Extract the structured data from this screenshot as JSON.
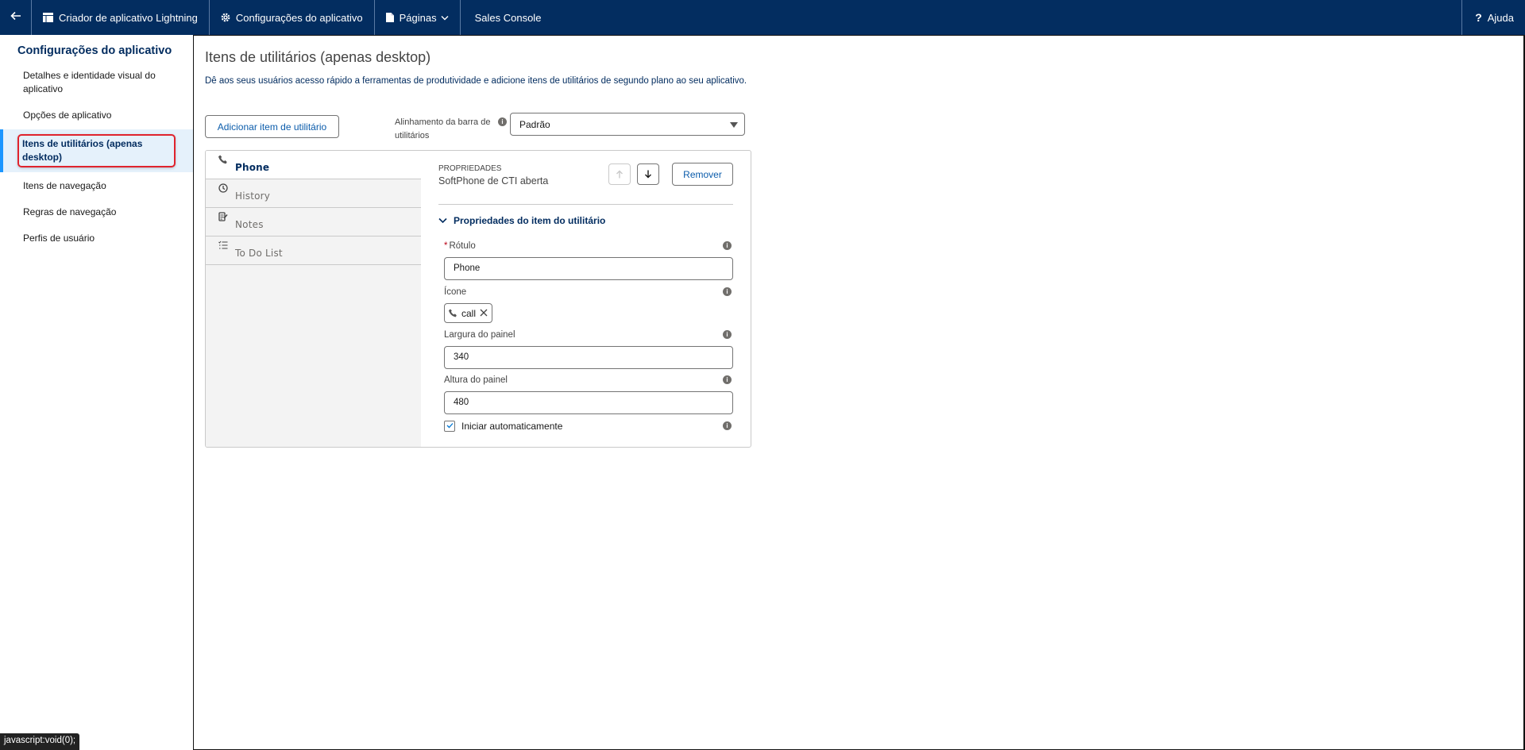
{
  "topbar": {
    "back_icon": "arrow-left-icon",
    "items": [
      {
        "label": "Criador de aplicativo Lightning",
        "icon": "app-builder-icon"
      },
      {
        "label": "Configurações do aplicativo",
        "icon": "gear-icon"
      },
      {
        "label": "Páginas",
        "icon": "page-icon",
        "dropdown": true
      },
      {
        "label": "Sales Console"
      }
    ],
    "help": {
      "label": "Ajuda",
      "icon": "question-icon"
    }
  },
  "sidebar": {
    "title": "Configurações do aplicativo",
    "items": [
      {
        "label": "Detalhes e identidade visual do aplicativo",
        "active": false
      },
      {
        "label": "Opções de aplicativo",
        "active": false
      },
      {
        "label": "Itens de utilitários (apenas desktop)",
        "active": true
      },
      {
        "label": "Itens de navegação",
        "active": false
      },
      {
        "label": "Regras de navegação",
        "active": false
      },
      {
        "label": "Perfis de usuário",
        "active": false
      }
    ]
  },
  "main": {
    "title": "Itens de utilitários (apenas desktop)",
    "description": "Dê aos seus usuários acesso rápido a ferramentas de produtividade e adicione itens de utilitários de segundo plano ao seu aplicativo.",
    "add_button": "Adicionar item de utilitário",
    "alignment": {
      "label": "Alinhamento da barra de utilitários",
      "value": "Padrão"
    },
    "utility_items": [
      {
        "label": "Phone",
        "icon": "phone-icon",
        "selected": true
      },
      {
        "label": "History",
        "icon": "clock-icon",
        "selected": false
      },
      {
        "label": "Notes",
        "icon": "notes-icon",
        "selected": false
      },
      {
        "label": "To Do List",
        "icon": "checklist-icon",
        "selected": false
      }
    ],
    "properties": {
      "caption": "PROPRIEDADES",
      "name": "SoftPhone de CTI aberta",
      "move_up_icon": "arrow-up-icon",
      "move_down_icon": "arrow-down-icon",
      "remove_button": "Remover",
      "section_title": "Propriedades do item do utilitário",
      "label_field": {
        "label": "Rótulo",
        "required_mark": "*",
        "value": "Phone"
      },
      "icon_field": {
        "label": "Ícone",
        "value": "call"
      },
      "width_field": {
        "label": "Largura do painel",
        "value": "340"
      },
      "height_field": {
        "label": "Altura do painel",
        "value": "480"
      },
      "autostart": {
        "label": "Iniciar automaticamente",
        "checked": true
      }
    }
  },
  "status_bar": {
    "url": "javascript:void(0);"
  }
}
